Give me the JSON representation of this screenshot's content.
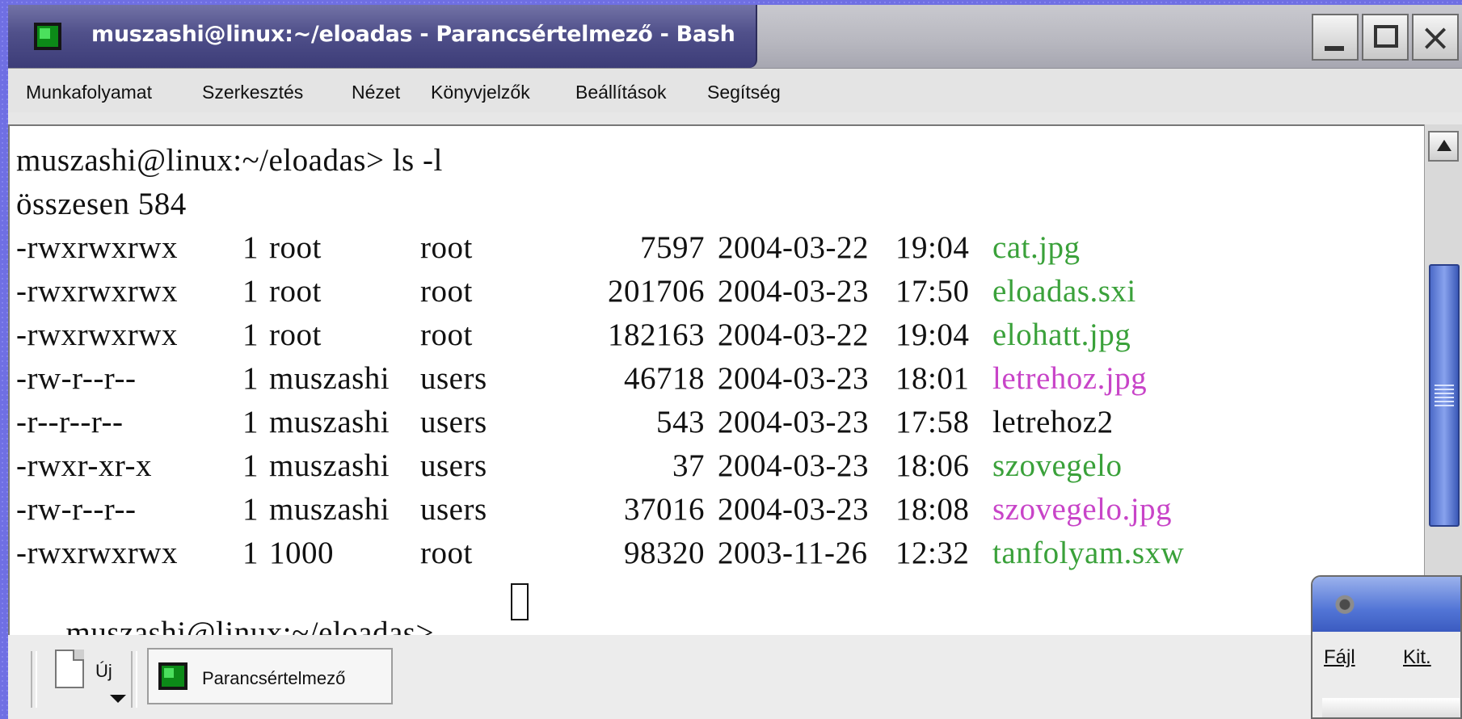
{
  "window": {
    "title": "muszashi@linux:~/eloadas - Parancsértelmező - Bash",
    "icon": "terminal-icon",
    "buttons": {
      "minimize": "minimize-icon",
      "maximize": "maximize-icon",
      "close": "×"
    }
  },
  "menubar": {
    "items": [
      "Munkafolyamat",
      "Szerkesztés",
      "Nézet",
      "Könyvjelzők",
      "Beállítások",
      "Segítség"
    ]
  },
  "terminal": {
    "prompt1": "muszashi@linux:~/eloadas> ls -l",
    "total": "összesen 584",
    "files": [
      {
        "perms": "-rwxrwxrwx",
        "links": "1",
        "owner": "root",
        "group": "root",
        "size": "7597",
        "date": "2004-03-22",
        "time": "19:04",
        "name": "cat.jpg",
        "color": "#3aa13a"
      },
      {
        "perms": "-rwxrwxrwx",
        "links": "1",
        "owner": "root",
        "group": "root",
        "size": "201706",
        "date": "2004-03-23",
        "time": "17:50",
        "name": "eloadas.sxi",
        "color": "#3aa13a"
      },
      {
        "perms": "-rwxrwxrwx",
        "links": "1",
        "owner": "root",
        "group": "root",
        "size": "182163",
        "date": "2004-03-22",
        "time": "19:04",
        "name": "elohatt.jpg",
        "color": "#3aa13a"
      },
      {
        "perms": "-rw-r--r--",
        "links": "1",
        "owner": "muszashi",
        "group": "users",
        "size": "46718",
        "date": "2004-03-23",
        "time": "18:01",
        "name": "letrehoz.jpg",
        "color": "#c844c8"
      },
      {
        "perms": "-r--r--r--",
        "links": "1",
        "owner": "muszashi",
        "group": "users",
        "size": "543",
        "date": "2004-03-23",
        "time": "17:58",
        "name": "letrehoz2",
        "color": "#111111"
      },
      {
        "perms": "-rwxr-xr-x",
        "links": "1",
        "owner": "muszashi",
        "group": "users",
        "size": "37",
        "date": "2004-03-23",
        "time": "18:06",
        "name": "szovegelo",
        "color": "#3aa13a"
      },
      {
        "perms": "-rw-r--r--",
        "links": "1",
        "owner": "muszashi",
        "group": "users",
        "size": "37016",
        "date": "2004-03-23",
        "time": "18:08",
        "name": "szovegelo.jpg",
        "color": "#c844c8"
      },
      {
        "perms": "-rwxrwxrwx",
        "links": "1",
        "owner": "1000",
        "group": "root",
        "size": "98320",
        "date": "2003-11-26",
        "time": "12:32",
        "name": "tanfolyam.sxw",
        "color": "#3aa13a"
      }
    ],
    "prompt2": "muszashi@linux:~/eloadas>"
  },
  "bottombar": {
    "new_label": "Új",
    "task_label": "Parancsértelmező"
  },
  "popup": {
    "menu_file": "Fájl",
    "menu_edit": "Kit."
  },
  "colors": {
    "title_bar": "#50508a",
    "executable": "#3aa13a",
    "image": "#c844c8",
    "scroll_thumb": "#4c6ac8"
  }
}
